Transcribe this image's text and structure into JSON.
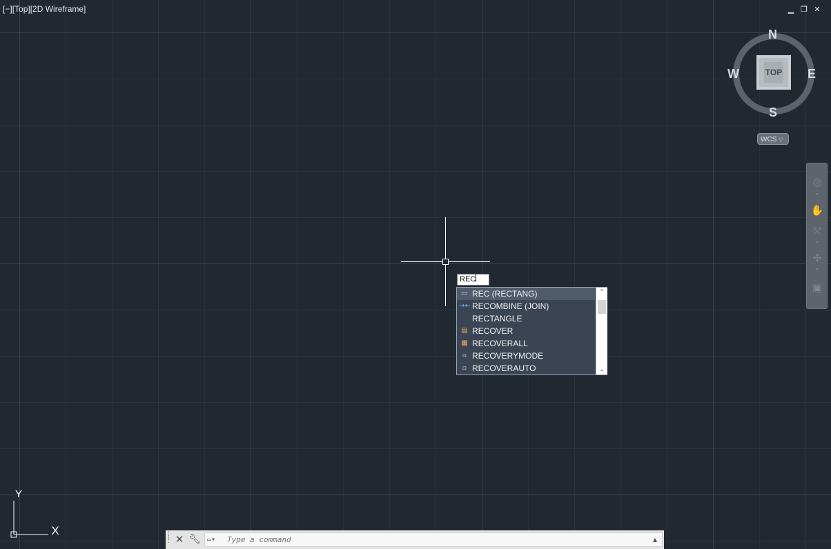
{
  "viewport": {
    "controls": [
      "[−]",
      "[Top]",
      "[2D Wireframe]"
    ],
    "window_buttons": [
      "minimize-icon",
      "restore-icon",
      "close-icon"
    ]
  },
  "viewcube": {
    "north": "N",
    "south": "S",
    "east": "E",
    "west": "W",
    "face": "TOP",
    "wcs_label": "WCS"
  },
  "navbar": {
    "tools": [
      "steering-wheel-icon",
      "pan-icon",
      "zoom-extents-icon",
      "orbit-icon",
      "showmotion-icon"
    ]
  },
  "dynamic_input": {
    "value": "REC"
  },
  "autocomplete": {
    "items": [
      {
        "label": "REC (RECTANG)",
        "icon": "rectangle-icon",
        "selected": true
      },
      {
        "label": "RECOMBINE (JOIN)",
        "icon": "join-icon",
        "selected": false
      },
      {
        "label": "RECTANGLE",
        "icon": "",
        "selected": false
      },
      {
        "label": "RECOVER",
        "icon": "recover-icon",
        "selected": false
      },
      {
        "label": "RECOVERALL",
        "icon": "recoverall-icon",
        "selected": false
      },
      {
        "label": "RECOVERYMODE",
        "icon": "sysvar-icon",
        "selected": false
      },
      {
        "label": "RECOVERAUTO",
        "icon": "sysvar-icon",
        "selected": false
      }
    ]
  },
  "ucs": {
    "x_label": "X",
    "y_label": "Y"
  },
  "commandline": {
    "placeholder": "Type a command"
  },
  "colors": {
    "background": "#212830",
    "grid_major": "#465264",
    "autocomplete_bg": "#3b4453"
  }
}
